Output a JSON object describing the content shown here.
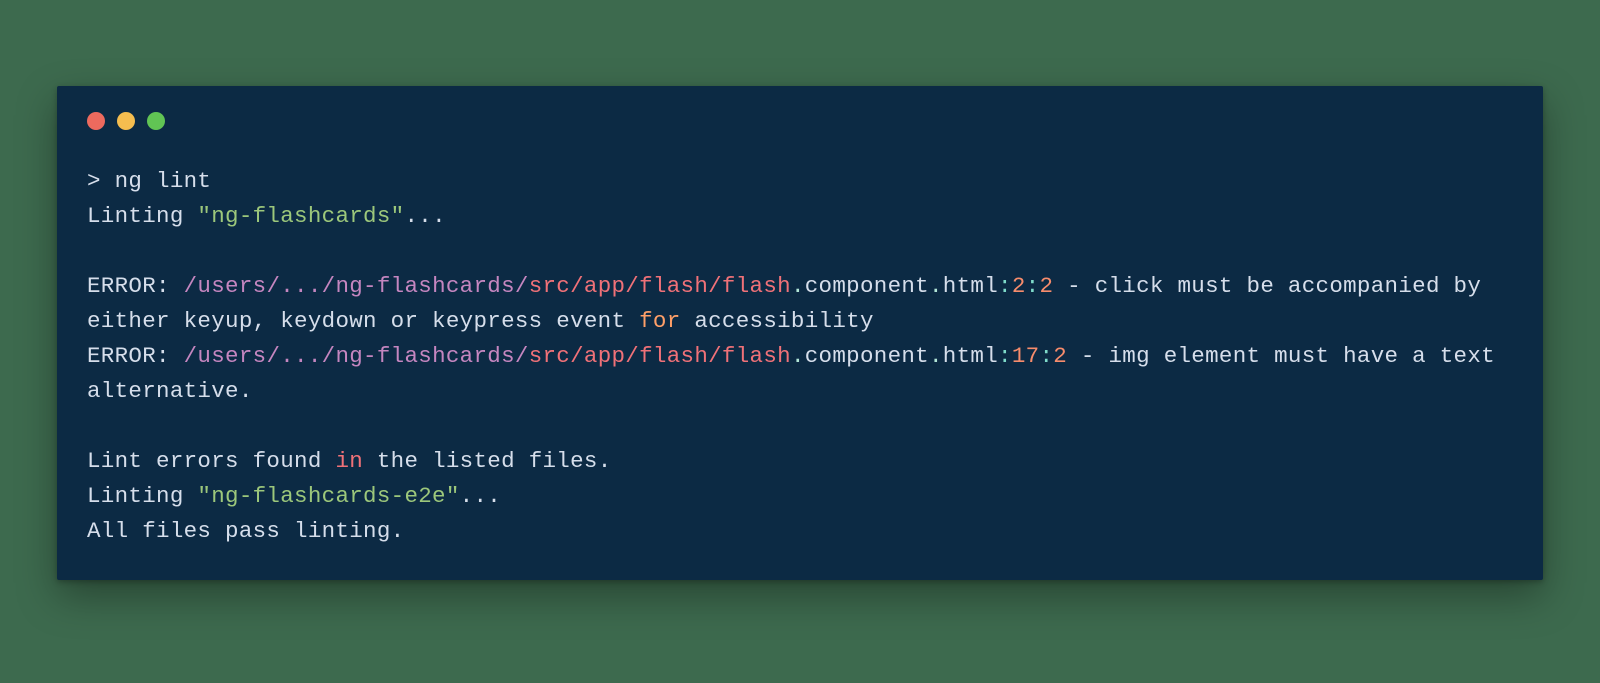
{
  "prompt": "> ",
  "command": "ng lint",
  "linting_prefix": "Linting ",
  "project1_quoted": "\"ng-flashcards\"",
  "ellipsis": "...",
  "error_label": "ERROR",
  "colon_space": ": ",
  "path_base": "/users/.../ng-flashcards/",
  "path_mid": "src/app/flash/flash",
  "dot": ".",
  "component_word": "component",
  "html_word": "html",
  "colon": ":",
  "err1_line": "2",
  "err1_col": "2",
  "dash": " - ",
  "err1_msg_part1": "click must be accompanied by either keyup, keydown or keypress event ",
  "for_word": "for",
  "err1_msg_part2": " accessibility",
  "err2_line": "17",
  "err2_col": "2",
  "err2_msg": "img element must have a text alternative.",
  "summary_prefix": "Lint errors found ",
  "in_word": "in",
  "summary_suffix": " the listed files.",
  "project2_quoted": "\"ng-flashcards-e2e\"",
  "all_pass": "All files pass linting."
}
